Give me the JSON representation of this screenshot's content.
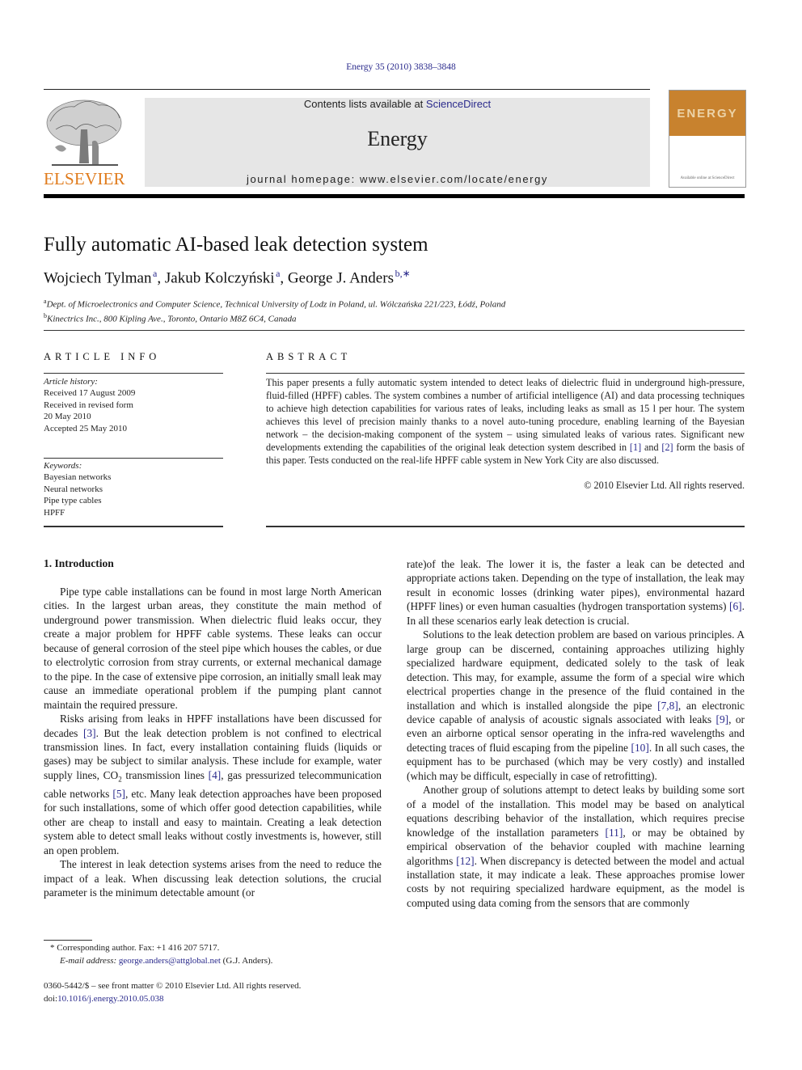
{
  "header": {
    "citation": "Energy 35 (2010) 3838–3848",
    "contents_prefix": "Contents lists available at ",
    "contents_link": "ScienceDirect",
    "journal_name": "Energy",
    "homepage": "journal homepage: www.elsevier.com/locate/energy",
    "publisher_logo": "ELSEVIER",
    "cover_title": "ENERGY",
    "cover_footer": "Available online at ScienceDirect"
  },
  "article": {
    "title": "Fully automatic AI-based leak detection system",
    "authors": [
      {
        "name": "Wojciech Tylman",
        "sup": "a"
      },
      {
        "name": "Jakub Kolczyński",
        "sup": "a"
      },
      {
        "name": "George J. Anders",
        "sup": "b,∗"
      }
    ],
    "affiliations": [
      {
        "sup": "a",
        "text": "Dept. of Microelectronics and Computer Science, Technical University of Lodz in Poland, ul. Wólczańska 221/223, Łódź, Poland"
      },
      {
        "sup": "b",
        "text": "Kinectrics Inc., 800 Kipling Ave., Toronto, Ontario M8Z 6C4, Canada"
      }
    ]
  },
  "article_info": {
    "heading": "ARTICLE INFO",
    "history_label": "Article history:",
    "history": [
      "Received 17 August 2009",
      "Received in revised form",
      "20 May 2010",
      "Accepted 25 May 2010"
    ],
    "keywords_label": "Keywords:",
    "keywords": [
      "Bayesian networks",
      "Neural networks",
      "Pipe type cables",
      "HPFF"
    ]
  },
  "abstract": {
    "heading": "ABSTRACT",
    "text_1": "This paper presents a fully automatic system intended to detect leaks of dielectric fluid in underground high-pressure, fluid-filled (HPFF) cables. The system combines a number of artificial intelligence (AI) and data processing techniques to achieve high detection capabilities for various rates of leaks, including leaks as small as 15 l per hour. The system achieves this level of precision mainly thanks to a novel auto-tuning procedure, enabling learning of the Bayesian network – the decision-making component of the system – using simulated leaks of various rates. Significant new developments extending the capabilities of the original leak detection system described in ",
    "ref_1": "[1]",
    "text_2": " and ",
    "ref_2": "[2]",
    "text_3": " form the basis of this paper. Tests conducted on the real-life HPFF cable system in New York City are also discussed.",
    "copyright": "© 2010 Elsevier Ltd. All rights reserved."
  },
  "body": {
    "section_heading": "1.  Introduction",
    "p1": "Pipe type cable installations can be found in most large North American cities. In the largest urban areas, they constitute the main method of underground power transmission. When dielectric fluid leaks occur, they create a major problem for HPFF cable systems. These leaks can occur because of general corrosion of the steel pipe which houses the cables, or due to electrolytic corrosion from stray currents, or external mechanical damage to the pipe. In the case of extensive pipe corrosion, an initially small leak may cause an immediate operational problem if the pumping plant cannot maintain the required pressure.",
    "p2_a": "Risks arising from leaks in HPFF installations have been discussed for decades ",
    "p2_r3": "[3]",
    "p2_b": ". But the leak detection problem is not confined to electrical transmission lines. In fact, every installation containing fluids (liquids or gases) may be subject to similar analysis. These include for example, water supply lines, CO",
    "p2_sub": "2",
    "p2_c": " transmission lines ",
    "p2_r4": "[4]",
    "p2_d": ", gas pressurized telecommunication cable networks ",
    "p2_r5": "[5]",
    "p2_e": ", etc. Many leak detection approaches have been proposed for such installations, some of which offer good detection capabilities, while other are cheap to install and easy to maintain. Creating a leak detection system able to detect small leaks without costly investments is, however, still an open problem.",
    "p3": "The interest in leak detection systems arises from the need to reduce the impact of a leak. When discussing leak detection solutions, the crucial parameter is the minimum detectable amount (or",
    "p3_cont_a": "rate)of the leak. The lower it is, the faster a leak can be detected and appropriate actions taken. Depending on the type of installation, the leak may result in economic losses (drinking water pipes), environmental hazard (HPFF lines) or even human casualties (hydrogen transportation systems) ",
    "p3_r6": "[6]",
    "p3_cont_b": ". In all these scenarios early leak detection is crucial.",
    "p4_a": "Solutions to the leak detection problem are based on various principles. A large group can be discerned, containing approaches utilizing highly specialized hardware equipment, dedicated solely to the task of leak detection. This may, for example, assume the form of a special wire which electrical properties change in the presence of the fluid contained in the installation and which is installed alongside the pipe ",
    "p4_r78": "[7,8]",
    "p4_b": ", an electronic device capable of analysis of acoustic signals associated with leaks ",
    "p4_r9": "[9]",
    "p4_c": ", or even an airborne optical sensor operating in the infra-red wavelengths and detecting traces of fluid escaping from the pipeline ",
    "p4_r10": "[10]",
    "p4_d": ". In all such cases, the equipment has to be purchased (which may be very costly) and installed (which may be difficult, especially in case of retrofitting).",
    "p5_a": "Another group of solutions attempt to detect leaks by building some sort of a model of the installation. This model may be based on analytical equations describing behavior of the installation, which requires precise knowledge of the installation parameters ",
    "p5_r11": "[11]",
    "p5_b": ", or may be obtained by empirical observation of the behavior coupled with machine learning algorithms ",
    "p5_r12": "[12]",
    "p5_c": ". When discrepancy is detected between the model and actual installation state, it may indicate a leak. These approaches promise lower costs by not requiring specialized hardware equipment, as the model is computed using data coming from the sensors that are commonly"
  },
  "footnotes": {
    "corresponding": "* Corresponding author. Fax: +1 416 207 5717.",
    "email_label": "E-mail address: ",
    "email": "george.anders@attglobal.net",
    "email_suffix": " (G.J. Anders).",
    "front_matter": "0360-5442/$ – see front matter © 2010 Elsevier Ltd. All rights reserved.",
    "doi_label": "doi:",
    "doi": "10.1016/j.energy.2010.05.038"
  }
}
